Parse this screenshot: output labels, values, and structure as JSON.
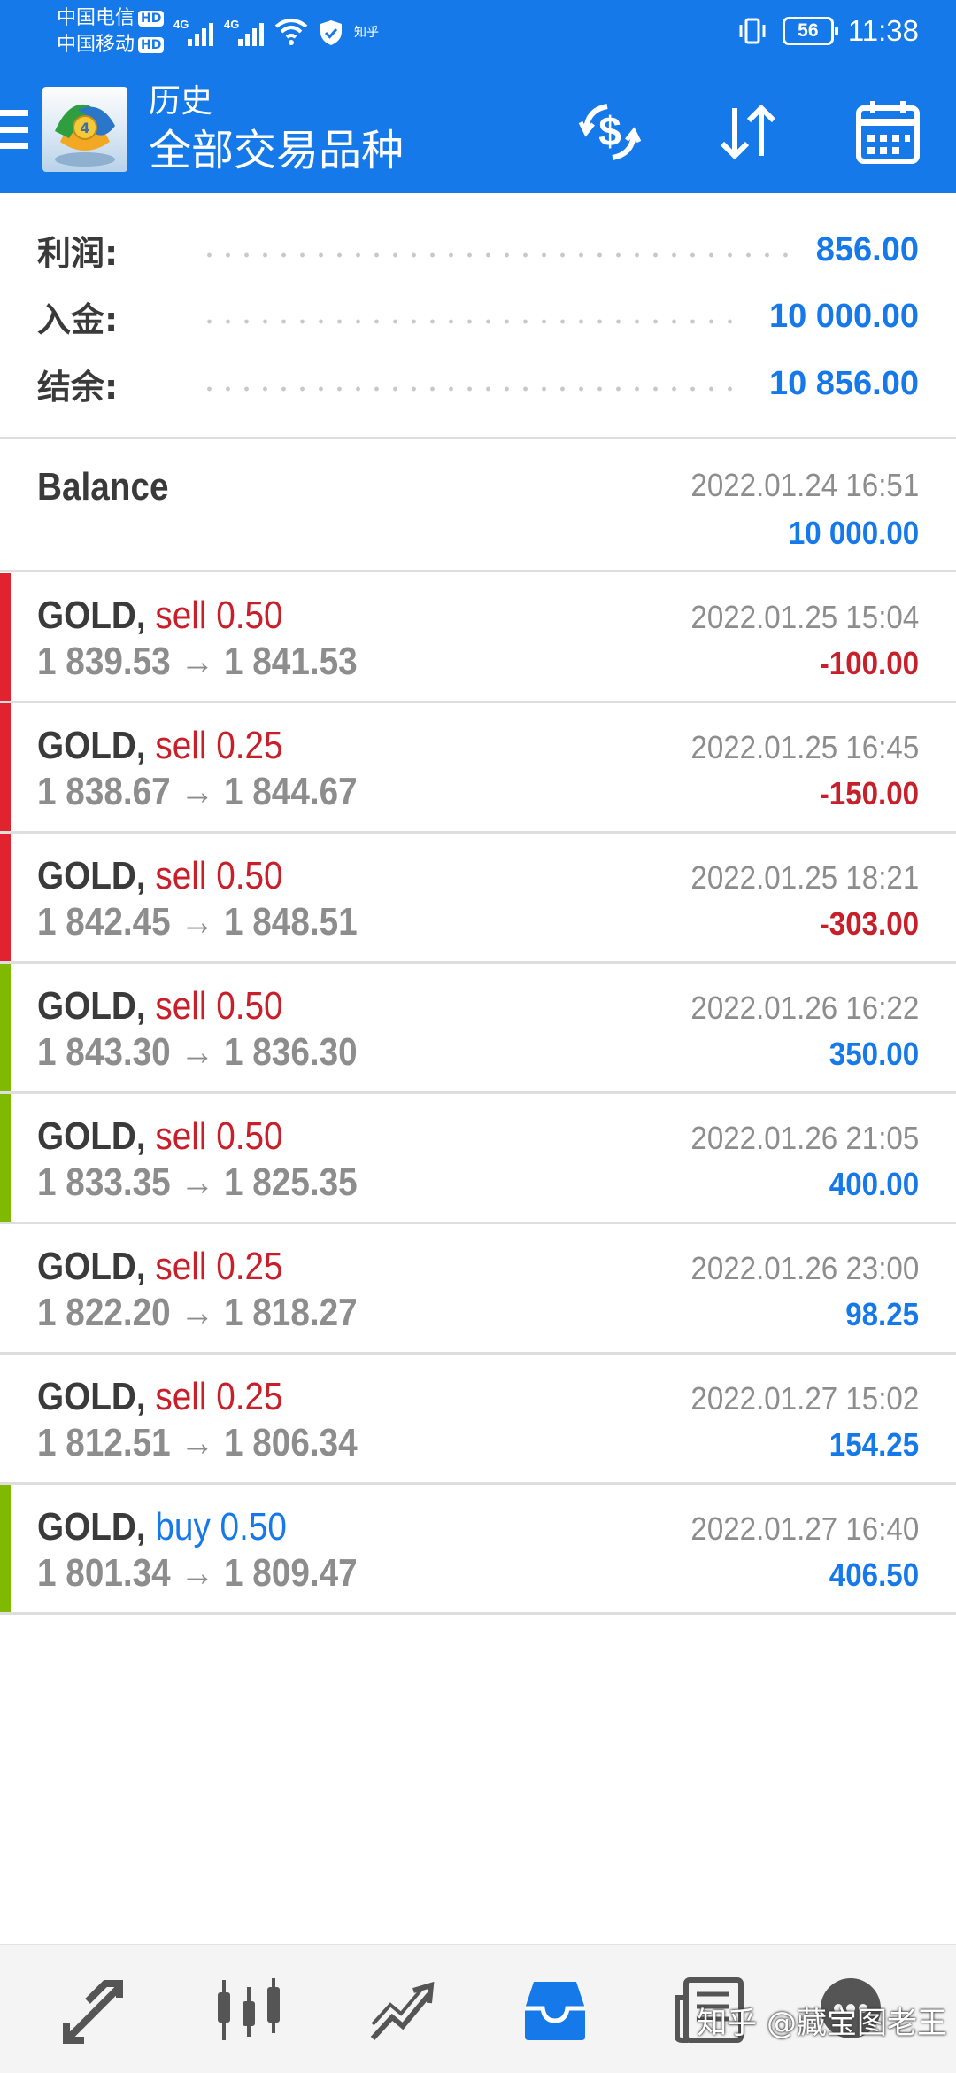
{
  "status_bar": {
    "carrier_1": "中国电信",
    "carrier_2": "中国移动",
    "hd_badge": "HD",
    "network_type": "4G",
    "notification_app": "知乎",
    "battery_level": "56",
    "time": "11:38"
  },
  "header": {
    "title": "历史",
    "subtitle": "全部交易品种",
    "icons": [
      "menu-icon",
      "metatrader-logo-icon",
      "currency-exchange-icon",
      "sort-icon",
      "calendar-icon"
    ],
    "accent_color": "#1579e9"
  },
  "summary": {
    "profit_label": "利润:",
    "profit_value": "856.00",
    "deposit_label": "入金:",
    "deposit_value": "10 000.00",
    "balance_label": "结余:",
    "balance_value": "10 856.00"
  },
  "balance_entry": {
    "title": "Balance",
    "time": "2022.01.24 16:51",
    "amount": "10 000.00"
  },
  "deals": [
    {
      "symbol": "GOLD,",
      "side": "sell 0.50",
      "direction": "sell",
      "prices": "1 839.53 → 1 841.53",
      "time": "2022.01.25 15:04",
      "profit": "-100.00",
      "result": "loss",
      "stripe": "#e0232f"
    },
    {
      "symbol": "GOLD,",
      "side": "sell 0.25",
      "direction": "sell",
      "prices": "1 838.67 → 1 844.67",
      "time": "2022.01.25 16:45",
      "profit": "-150.00",
      "result": "loss",
      "stripe": "#e0232f"
    },
    {
      "symbol": "GOLD,",
      "side": "sell 0.50",
      "direction": "sell",
      "prices": "1 842.45 → 1 848.51",
      "time": "2022.01.25 18:21",
      "profit": "-303.00",
      "result": "loss",
      "stripe": "#e0232f"
    },
    {
      "symbol": "GOLD,",
      "side": "sell 0.50",
      "direction": "sell",
      "prices": "1 843.30 → 1 836.30",
      "time": "2022.01.26 16:22",
      "profit": "350.00",
      "result": "profit",
      "stripe": "#7fba00"
    },
    {
      "symbol": "GOLD,",
      "side": "sell 0.50",
      "direction": "sell",
      "prices": "1 833.35 → 1 825.35",
      "time": "2022.01.26 21:05",
      "profit": "400.00",
      "result": "profit",
      "stripe": "#7fba00"
    },
    {
      "symbol": "GOLD,",
      "side": "sell 0.25",
      "direction": "sell",
      "prices": "1 822.20 → 1 818.27",
      "time": "2022.01.26 23:00",
      "profit": "98.25",
      "result": "profit",
      "stripe": ""
    },
    {
      "symbol": "GOLD,",
      "side": "sell 0.25",
      "direction": "sell",
      "prices": "1 812.51 → 1 806.34",
      "time": "2022.01.27 15:02",
      "profit": "154.25",
      "result": "profit",
      "stripe": ""
    },
    {
      "symbol": "GOLD,",
      "side": "buy 0.50",
      "direction": "buy",
      "prices": "1 801.34 → 1 809.47",
      "time": "2022.01.27 16:40",
      "profit": "406.50",
      "result": "profit",
      "stripe": "#7fba00"
    }
  ],
  "bottom_nav": {
    "items": [
      "quotes-icon",
      "chart-icon",
      "trade-icon",
      "history-icon",
      "news-icon",
      "chat-icon"
    ],
    "active": "history-icon"
  },
  "watermark": "知乎 @藏宝图老王"
}
